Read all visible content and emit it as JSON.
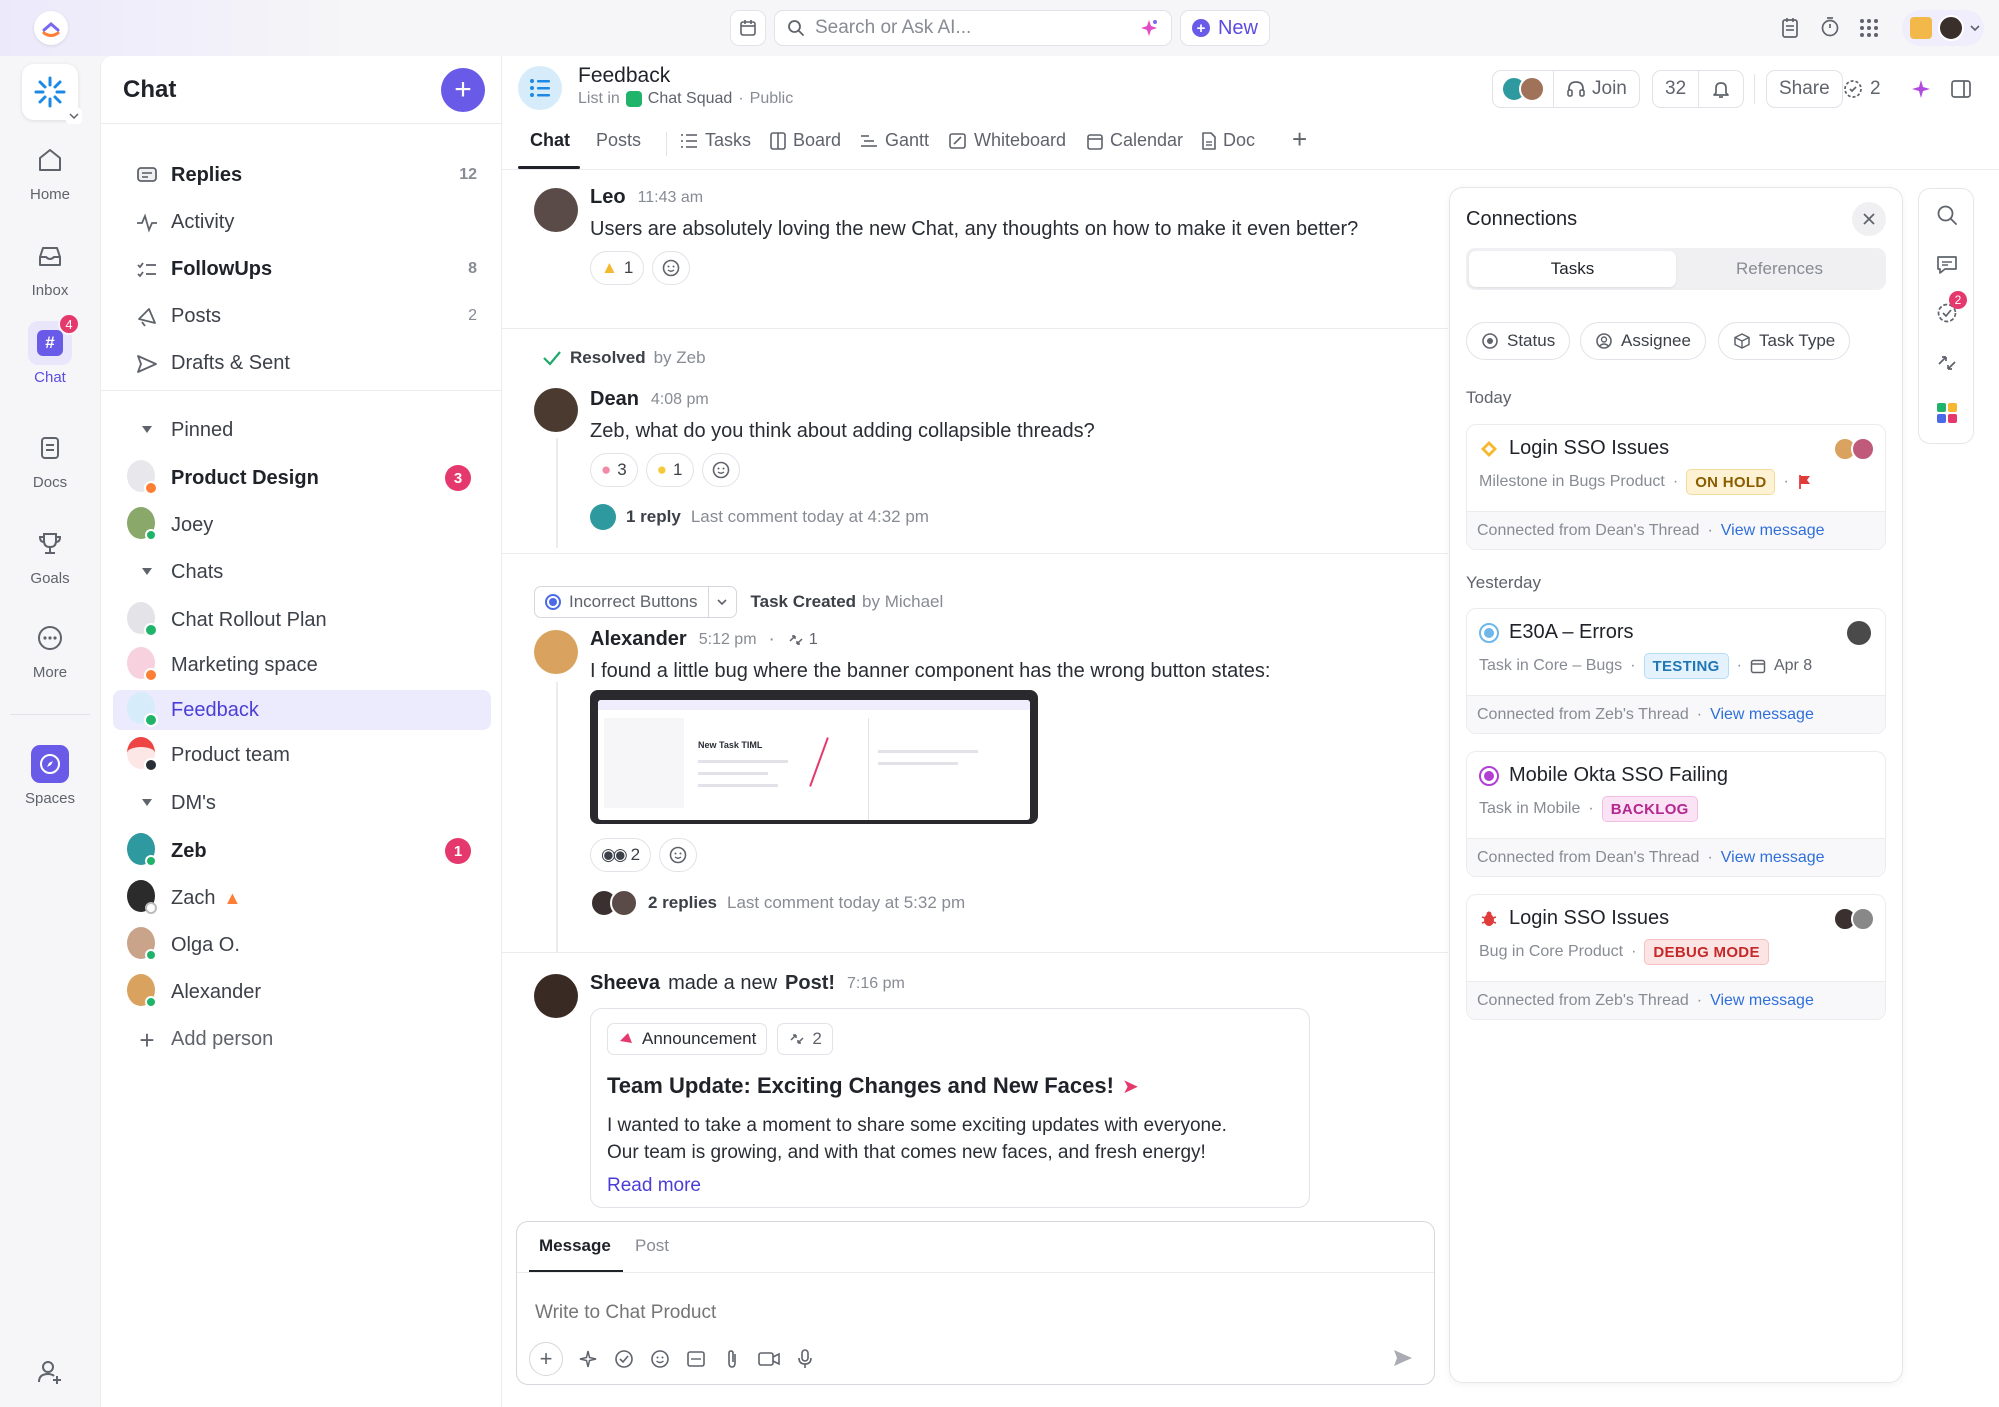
{
  "topbar": {
    "search_placeholder": "Search or Ask AI...",
    "new_label": "New"
  },
  "rail": {
    "items": [
      {
        "label": "Home"
      },
      {
        "label": "Inbox"
      },
      {
        "label": "Chat",
        "badge": "4"
      },
      {
        "label": "Docs"
      },
      {
        "label": "Goals"
      },
      {
        "label": "More"
      },
      {
        "label": "Spaces"
      }
    ]
  },
  "sidebar": {
    "title": "Chat",
    "nav": [
      {
        "label": "Replies",
        "count": "12"
      },
      {
        "label": "Activity",
        "count": ""
      },
      {
        "label": "FollowUps",
        "count": "8"
      },
      {
        "label": "Posts",
        "count": "2"
      },
      {
        "label": "Drafts & Sent",
        "count": ""
      }
    ],
    "pinned_label": "Pinned",
    "pinned": [
      {
        "label": "Product Design",
        "badge": "3"
      },
      {
        "label": "Joey"
      }
    ],
    "chats_label": "Chats",
    "chats": [
      {
        "label": "Chat Rollout Plan"
      },
      {
        "label": "Marketing space"
      },
      {
        "label": "Feedback"
      },
      {
        "label": "Product team"
      }
    ],
    "dms_label": "DM's",
    "dms": [
      {
        "label": "Zeb",
        "badge": "1"
      },
      {
        "label": "Zach"
      },
      {
        "label": "Olga O."
      },
      {
        "label": "Alexander"
      }
    ],
    "add_person": "Add person"
  },
  "header": {
    "title": "Feedback",
    "list_in": "List in",
    "space": "Chat Squad",
    "visibility": "Public",
    "join": "Join",
    "member_count": "32",
    "share": "Share",
    "ai_count": "2"
  },
  "tabs": [
    "Chat",
    "Posts",
    "Tasks",
    "Board",
    "Gantt",
    "Whiteboard",
    "Calendar",
    "Doc"
  ],
  "messages": {
    "leo": {
      "name": "Leo",
      "time": "11:43 am",
      "text": "Users are absolutely loving the new Chat, any thoughts on how to make it even better?",
      "reaction_count": "1"
    },
    "resolved": {
      "label": "Resolved",
      "by": "by Zeb"
    },
    "dean": {
      "name": "Dean",
      "time": "4:08 pm",
      "text": "Zeb, what do you think about adding collapsible threads?",
      "r1": "3",
      "r2": "1",
      "reply": "1 reply",
      "last": "Last comment today at 4:32 pm"
    },
    "task": {
      "label": "Incorrect Buttons",
      "created": "Task Created",
      "by": "by Michael"
    },
    "alexander": {
      "name": "Alexander",
      "time": "5:12 pm",
      "links": "1",
      "text": "I found a little bug where the banner component has the wrong button states:",
      "reaction_count": "2",
      "reply": "2 replies",
      "last": "Last comment today at 5:32 pm",
      "shot_title": "New Task TIML"
    },
    "sheeva": {
      "name": "Sheeva",
      "made": "made a new",
      "post": "Post!",
      "time": "7:16 pm",
      "tag": "Announcement",
      "links": "2",
      "post_title": "Team Update: Exciting Changes and New Faces!",
      "line1": "I wanted to take a moment to share some exciting updates with everyone.",
      "line2": "Our team is growing, and with that comes new faces, and fresh energy!",
      "read_more": "Read more"
    }
  },
  "composer": {
    "tab_message": "Message",
    "tab_post": "Post",
    "placeholder": "Write to Chat Product"
  },
  "connections": {
    "title": "Connections",
    "tab_tasks": "Tasks",
    "tab_refs": "References",
    "filters": [
      "Status",
      "Assignee",
      "Task Type"
    ],
    "today": "Today",
    "yesterday": "Yesterday",
    "view": "View message",
    "cards": [
      {
        "title": "Login SSO Issues",
        "sub": "Milestone in Bugs Product",
        "status": "ON HOLD",
        "from": "Connected from Dean's Thread"
      },
      {
        "title": "E30A – Errors",
        "sub": "Task in Core – Bugs",
        "status": "TESTING",
        "date": "Apr 8",
        "from": "Connected from Zeb's Thread"
      },
      {
        "title": "Mobile Okta SSO Failing",
        "sub": "Task in Mobile",
        "status": "BACKLOG",
        "from": "Connected from Dean's Thread"
      },
      {
        "title": "Login SSO Issues",
        "sub": "Bug in Core Product",
        "status": "DEBUG MODE",
        "from": "Connected from Zeb's Thread"
      }
    ]
  },
  "strip_badge": "2",
  "colors": {
    "accent": "#7b68ee",
    "brand_purple": "#5b4ce0",
    "badge_red": "#e5386c",
    "link_blue": "#2f6fdb"
  }
}
